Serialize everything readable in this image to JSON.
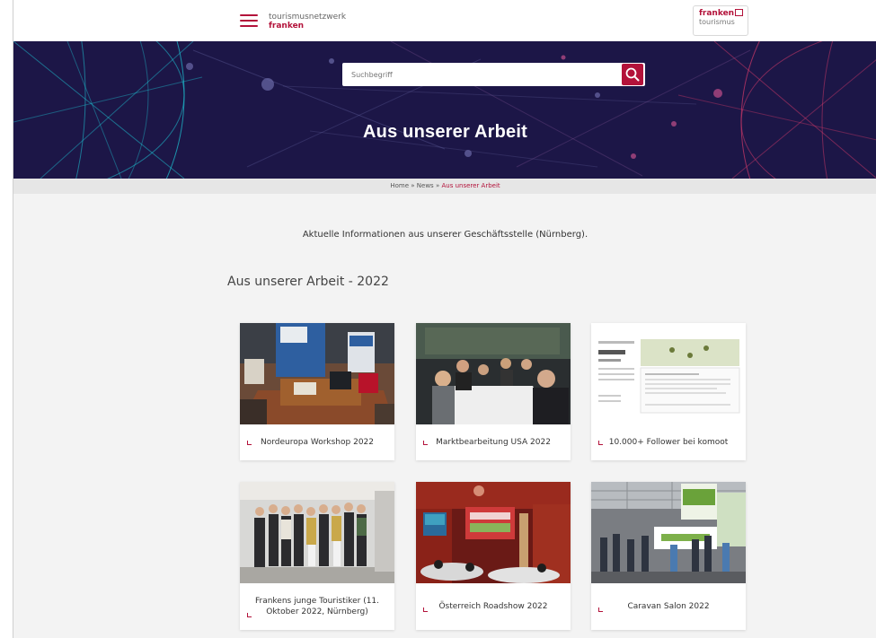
{
  "header": {
    "brand_line1": "tourismusnetzwerk",
    "brand_line2": "franken",
    "logo_line1": "franken",
    "logo_line2": "tourismus"
  },
  "search": {
    "placeholder": "Suchbegriff"
  },
  "hero": {
    "title": "Aus unserer Arbeit"
  },
  "breadcrumb": {
    "items": [
      "Home",
      "News",
      "Aus unserer Arbeit"
    ],
    "separator": "»"
  },
  "intro": "Aktuelle Informationen aus unserer Geschäftsstelle (Nürnberg).",
  "section": {
    "title": "Aus unserer Arbeit - 2022"
  },
  "cards": [
    {
      "title": "Nordeuropa Workshop 2022"
    },
    {
      "title": "Marktbearbeitung USA 2022"
    },
    {
      "title": "10.000+ Follower bei komoot"
    },
    {
      "title": "Frankens junge Touristiker (11. Oktober 2022, Nürnberg)"
    },
    {
      "title": "Österreich Roadshow 2022"
    },
    {
      "title": "Caravan Salon 2022"
    }
  ],
  "colors": {
    "accent": "#b3123a",
    "hero_bg": "#1c1647",
    "page_bg": "#f3f3f3"
  },
  "icons": [
    "menu-icon",
    "search-icon"
  ]
}
